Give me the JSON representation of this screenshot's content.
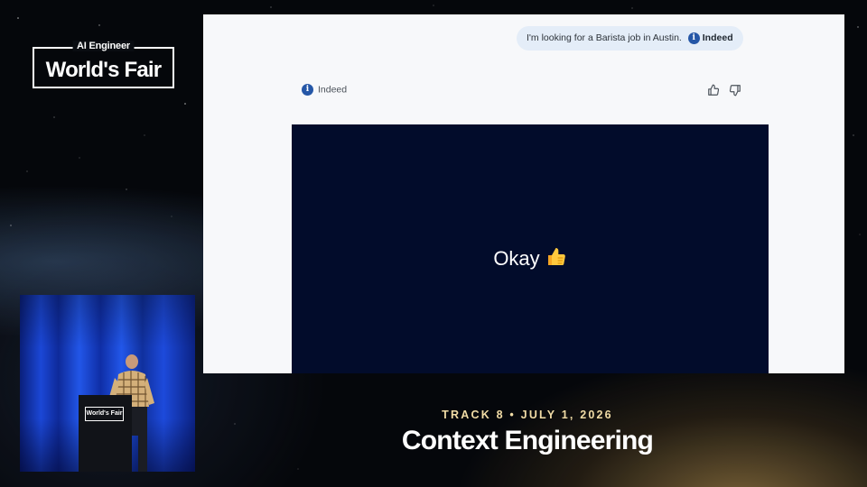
{
  "event_logo": {
    "small_text": "AI Engineer",
    "big_text": "World's Fair"
  },
  "chat": {
    "user_message": "I'm looking for a Barista job in Austin.",
    "user_message_tag": "Indeed",
    "agent_name": "Indeed",
    "info_icon": "info-icon",
    "feedback": {
      "like_icon": "thumbs-up-icon",
      "dislike_icon": "thumbs-down-icon"
    }
  },
  "video_panel": {
    "text": "Okay",
    "emoji_icon": "thumbs-up-emoji-icon"
  },
  "speaker_feed": {
    "podium_sign_big": "World's Fair"
  },
  "talk": {
    "track_line": "TRACK 8 • JULY 1, 2026",
    "title": "Context Engineering"
  },
  "colors": {
    "brand_blue": "#2557a7",
    "video_bg": "#020c2b",
    "track_gold": "#f1dca6"
  }
}
